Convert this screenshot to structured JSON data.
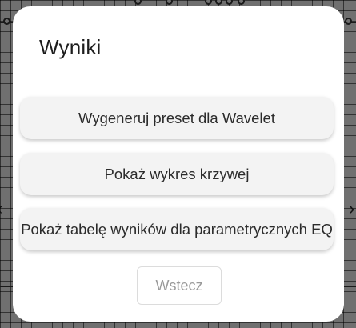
{
  "dialog": {
    "title": "Wyniki",
    "options": [
      {
        "label": "Wygeneruj preset dla Wavelet"
      },
      {
        "label": "Pokaż wykres krzywej"
      },
      {
        "label": "Pokaż tabelę wyników dla parametrycznych EQ"
      }
    ],
    "back_label": "Wstecz"
  },
  "colors": {
    "dialog_bg": "#ffffff",
    "button_bg": "#f3f3f3",
    "scrim": "#707070"
  },
  "icons": {
    "left_edge": "chevron-left-icon",
    "right_edge": "chevron-right-icon"
  }
}
